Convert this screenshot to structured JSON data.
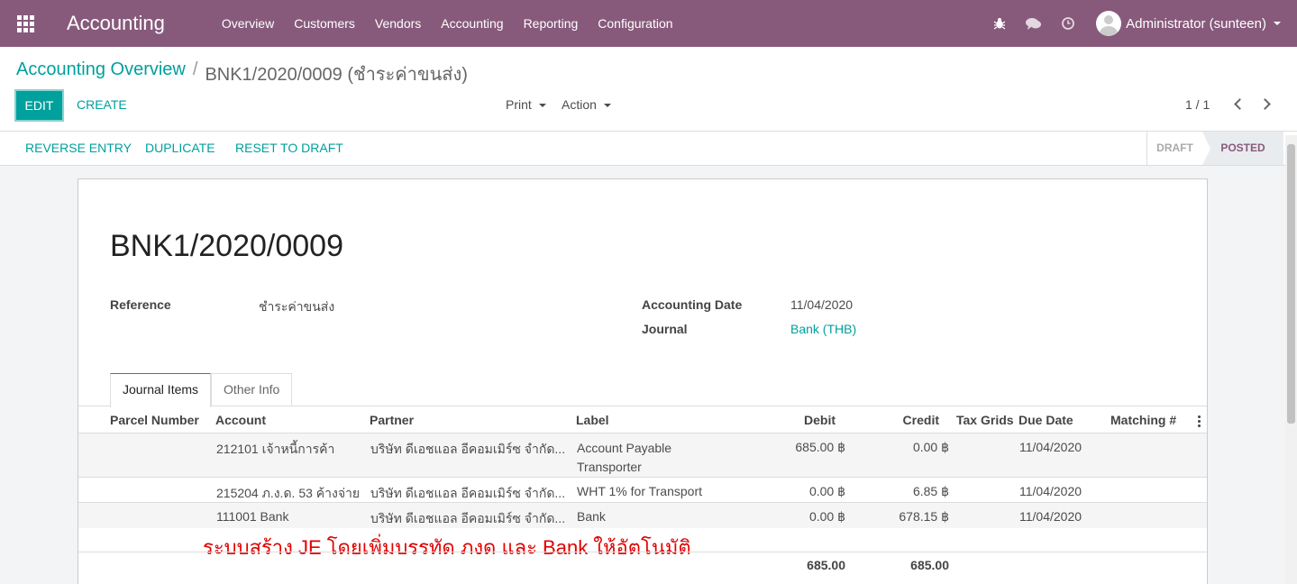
{
  "navbar": {
    "brand": "Accounting",
    "menu": [
      "Overview",
      "Customers",
      "Vendors",
      "Accounting",
      "Reporting",
      "Configuration"
    ],
    "user": "Administrator (sunteen)"
  },
  "breadcrumb": {
    "parent": "Accounting Overview",
    "separator": "/",
    "current": "BNK1/2020/0009 (ชำระค่าขนส่ง)"
  },
  "toolbar": {
    "edit": "EDIT",
    "create": "CREATE",
    "print": "Print",
    "action": "Action",
    "pager": "1 / 1"
  },
  "statusbar": {
    "buttons": [
      "REVERSE ENTRY",
      "DUPLICATE",
      "RESET TO DRAFT"
    ],
    "stages": [
      "DRAFT",
      "POSTED"
    ],
    "active_stage": "POSTED"
  },
  "form": {
    "title": "BNK1/2020/0009",
    "reference_label": "Reference",
    "reference_value": "ชำระค่าขนส่ง",
    "accounting_date_label": "Accounting Date",
    "accounting_date_value": "11/04/2020",
    "journal_label": "Journal",
    "journal_value": "Bank (THB)"
  },
  "tabs": [
    "Journal Items",
    "Other Info"
  ],
  "grid": {
    "columns": [
      "Parcel Number",
      "Account",
      "Partner",
      "Label",
      "Debit",
      "Credit",
      "Tax Grids",
      "Due Date",
      "Matching #"
    ],
    "rows": [
      {
        "account": "212101 เจ้าหนี้การค้า",
        "partner": "บริษัท ดีเอชแอล อีคอมเมิร์ซ จำกัด...",
        "label": "Account Payable Transporter",
        "debit": "685.00 ฿",
        "credit": "0.00 ฿",
        "due": "11/04/2020"
      },
      {
        "account": "215204 ภ.ง.ด. 53 ค้างจ่าย",
        "partner": "บริษัท ดีเอชแอล อีคอมเมิร์ซ จำกัด...",
        "label": "WHT 1% for Transport",
        "debit": "0.00 ฿",
        "credit": "6.85 ฿",
        "due": "11/04/2020"
      },
      {
        "account": "111001 Bank",
        "partner": "บริษัท ดีเอชแอล อีคอมเมิร์ซ จำกัด...",
        "label": "Bank",
        "debit": "0.00 ฿",
        "credit": "678.15 ฿",
        "due": "11/04/2020"
      }
    ],
    "total_debit": "685.00",
    "total_credit": "685.00"
  },
  "annotation": "ระบบสร้าง JE โดยเพิ่มบรรทัด ภงด และ Bank ให้อัตโนมัติ"
}
